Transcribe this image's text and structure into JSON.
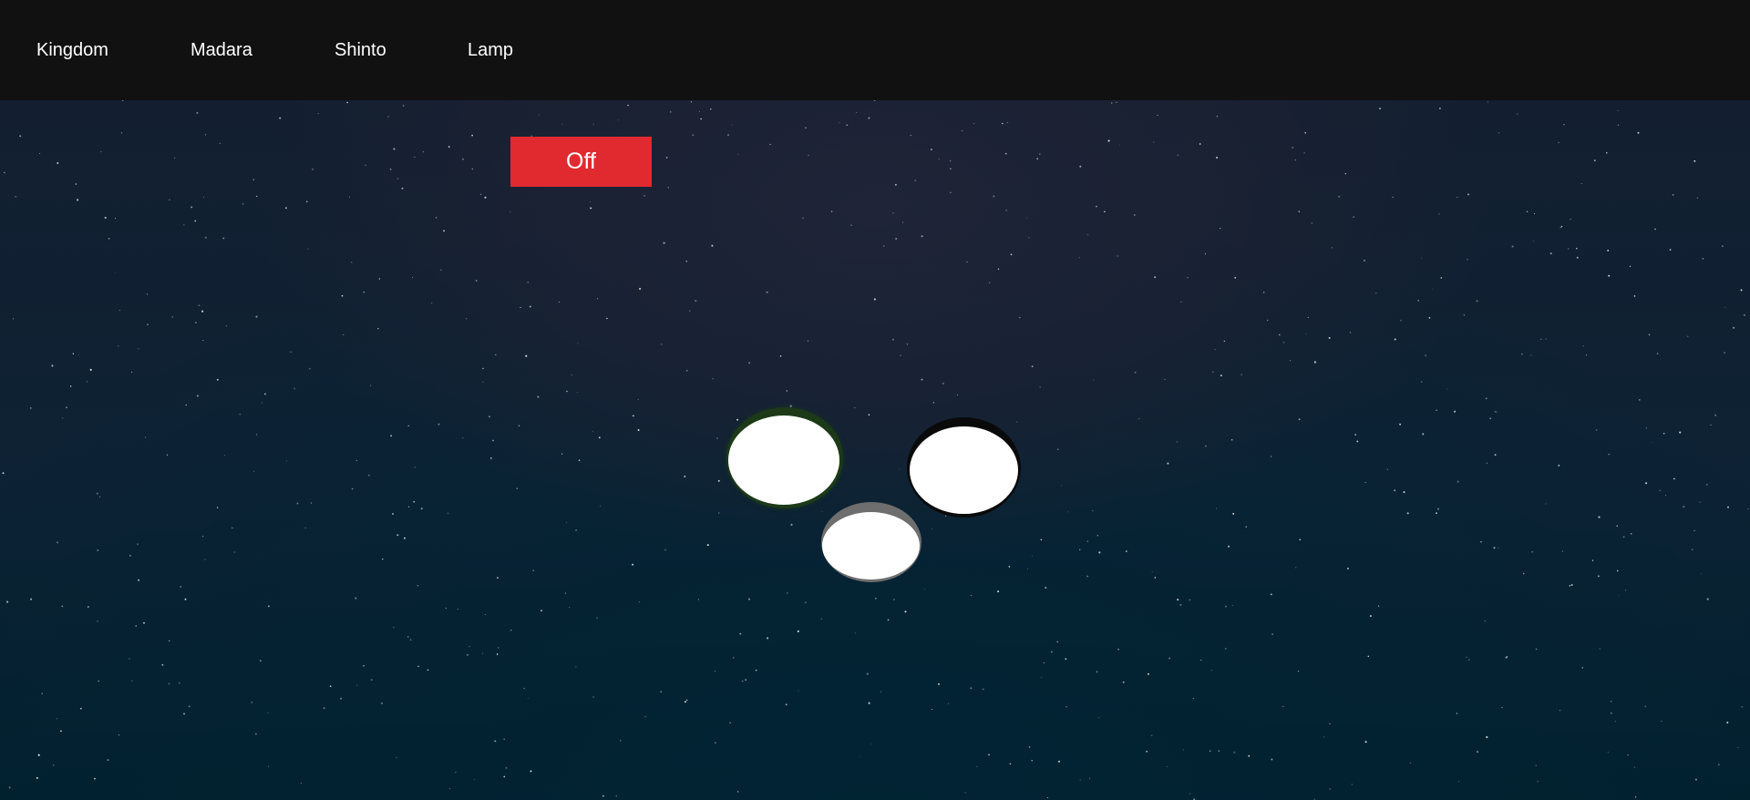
{
  "nav": {
    "items": [
      {
        "label": "Kingdom"
      },
      {
        "label": "Madara"
      },
      {
        "label": "Shinto"
      },
      {
        "label": "Lamp"
      }
    ]
  },
  "toggle": {
    "label": "Off",
    "color": "#e02a2f"
  },
  "lamps": [
    {
      "name": "left",
      "rim_color": "#1c3a17"
    },
    {
      "name": "right",
      "rim_color": "#0a0a0a"
    },
    {
      "name": "bottom",
      "rim_color": "#6e6e6e"
    }
  ],
  "colors": {
    "navbar": "#111111",
    "lamp_light": "#ffffff"
  }
}
